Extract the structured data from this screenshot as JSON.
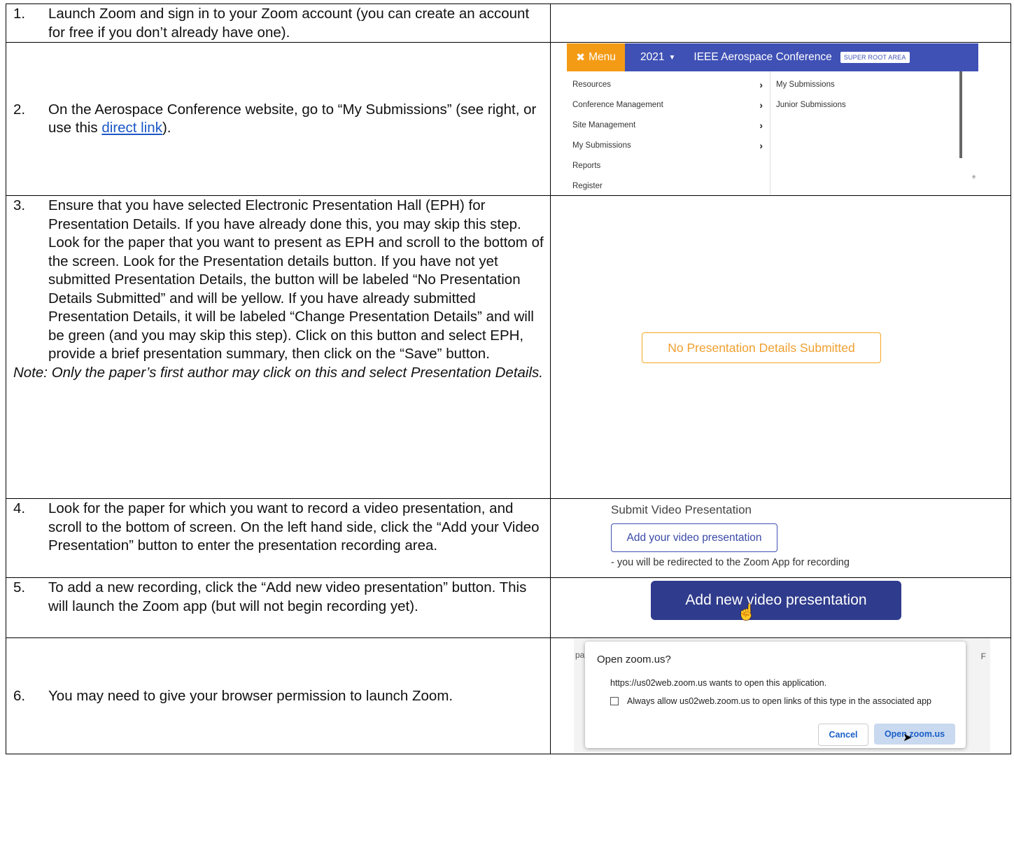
{
  "steps": [
    {
      "num": "1.",
      "text": "Launch Zoom and sign in to your Zoom account (you can create an account for free if you don’t already have one)."
    },
    {
      "num": "2.",
      "text_before": "On the Aerospace Conference website, go to “My Submissions” (see right, or use this ",
      "link": "direct link",
      "text_after": ")."
    },
    {
      "num": "3.",
      "para1": "Ensure that you have selected Electronic Presentation Hall (EPH) for Presentation Details.  If you have already done this, you may skip this step.",
      "para2": "Look for the paper that you want to present as EPH and scroll to the bottom of the screen.  Look for the Presentation details button.   If you have not yet submitted Presentation Details, the button will be labeled “No Presentation Details Submitted” and will be yellow.  If you have already submitted Presentation Details, it will be labeled “Change Presentation Details” and will be green (and you may skip this step).  Click on this button and select EPH, provide a brief presentation summary, then click on the “Save” button.",
      "note": "Note: Only the paper’s first author may click on this and select Presentation Details."
    },
    {
      "num": "4.",
      "text": "Look for the paper for which you want to record a video presentation, and scroll to the bottom of screen.  On the left hand side, click the “Add your Video Presentation” button to enter the presentation recording area."
    },
    {
      "num": "5.",
      "text": "To add a new recording, click the “Add new video presentation” button. This will launch the Zoom app (but will not begin recording yet)."
    },
    {
      "num": "6.",
      "text": "You may need to give your browser permission to launch Zoom."
    }
  ],
  "menu_shot": {
    "menu_label": "Menu",
    "year": "2021",
    "conference": "IEEE Aerospace Conference",
    "badge": "SUPER ROOT AREA",
    "items": [
      "Resources",
      "Conference Management",
      "Site Management",
      "My Submissions",
      "Reports",
      "Register"
    ],
    "sub_items": [
      "My Submissions",
      "Junior Submissions"
    ],
    "edge_char": "e"
  },
  "yellow_button": "No Presentation Details Submitted",
  "video_shot": {
    "title": "Submit Video Presentation",
    "button": "Add your video presentation",
    "note": "- you will be redirected to the Zoom App for recording"
  },
  "new_video_button": "Add new video presentation",
  "dialog_shot": {
    "frag_left": "pa",
    "frag_right": "F",
    "title": "Open zoom.us?",
    "message": "https://us02web.zoom.us wants to open this application.",
    "checkbox_label": "Always allow us02web.zoom.us to open links of this type in the associated app",
    "cancel": "Cancel",
    "open": "Open zoom.us"
  },
  "colors": {
    "menu_orange": "#f49b16",
    "menu_blue": "#3f51b5",
    "yellow_border": "#f5a623",
    "link_blue": "#1a56c6"
  }
}
